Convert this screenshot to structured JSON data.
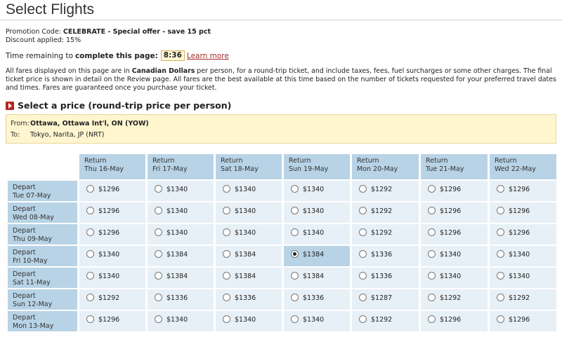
{
  "page": {
    "title": "Select Flights"
  },
  "promo": {
    "code_label": "Promotion Code:",
    "code_value": "CELEBRATE - Special offer - save 15 pct",
    "discount_text": "Discount applied: 15%"
  },
  "timer": {
    "label_prefix": "Time remaining to",
    "label_bold": "complete this page:",
    "value": "8:36",
    "learn_more": "Learn more"
  },
  "fares_note": {
    "part1": "All fares displayed on this page are in",
    "currency": "Canadian Dollars",
    "part2": "per person, for a round-trip ticket, and include taxes, fees, fuel surcharges or some other charges. The final ticket price is shown in detail on the Review page. All fares are the best available at this time based on the number of tickets requested for your preferred travel dates and times. Fares are guaranteed once you purchase your ticket."
  },
  "section": {
    "heading": "Select a price (round-trip price per person)"
  },
  "route": {
    "from_label": "From:",
    "from_value": "Ottawa, Ottawa Int'l, ON (YOW)",
    "to_label": "To:",
    "to_value": "Tokyo, Narita, JP (NRT)"
  },
  "grid": {
    "return_label": "Return",
    "depart_label": "Depart",
    "columns": [
      "Thu 16-May",
      "Fri 17-May",
      "Sat 18-May",
      "Sun 19-May",
      "Mon 20-May",
      "Tue 21-May",
      "Wed 22-May"
    ],
    "rows": [
      {
        "date": "Tue 07-May",
        "prices": [
          "$1296",
          "$1340",
          "$1340",
          "$1340",
          "$1292",
          "$1296",
          "$1296"
        ]
      },
      {
        "date": "Wed 08-May",
        "prices": [
          "$1296",
          "$1340",
          "$1340",
          "$1340",
          "$1292",
          "$1296",
          "$1296"
        ]
      },
      {
        "date": "Thu 09-May",
        "prices": [
          "$1296",
          "$1340",
          "$1340",
          "$1340",
          "$1292",
          "$1296",
          "$1296"
        ]
      },
      {
        "date": "Fri 10-May",
        "prices": [
          "$1340",
          "$1384",
          "$1384",
          "$1384",
          "$1336",
          "$1340",
          "$1340"
        ]
      },
      {
        "date": "Sat 11-May",
        "prices": [
          "$1340",
          "$1384",
          "$1384",
          "$1384",
          "$1336",
          "$1340",
          "$1340"
        ]
      },
      {
        "date": "Sun 12-May",
        "prices": [
          "$1292",
          "$1336",
          "$1336",
          "$1336",
          "$1287",
          "$1292",
          "$1292"
        ]
      },
      {
        "date": "Mon 13-May",
        "prices": [
          "$1296",
          "$1340",
          "$1340",
          "$1340",
          "$1292",
          "$1296",
          "$1296"
        ]
      }
    ],
    "selected": {
      "row": 3,
      "col": 3
    }
  }
}
